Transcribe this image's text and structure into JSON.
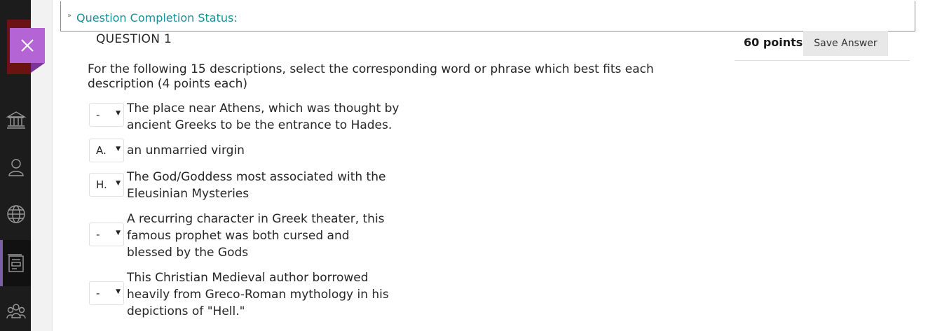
{
  "status": {
    "label": "Question Completion Status:"
  },
  "question": {
    "title": "QUESTION 1",
    "points": "60 points",
    "save_label": "Save Answer",
    "intro_line1": "For the following 15 descriptions, select the corresponding word or phrase which best fits each",
    "intro_line2": "description (4 points each)"
  },
  "items": [
    {
      "selected": "-",
      "lines": [
        "The place near Athens, which was thought by",
        "ancient Greeks to be the entrance to Hades."
      ]
    },
    {
      "selected": "A.",
      "lines": [
        "an unmarried virgin"
      ]
    },
    {
      "selected": "H.",
      "lines": [
        "The God/Goddess most associated with the",
        "Eleusinian Mysteries"
      ]
    },
    {
      "selected": "-",
      "lines": [
        "A recurring character in Greek theater, this",
        "famous prophet was both cursed and",
        "blessed by the Gods"
      ]
    },
    {
      "selected": "-",
      "lines": [
        "This Christian Medieval author borrowed",
        "heavily from Greco-Roman mythology in his",
        "depictions of \"Hell.\""
      ]
    }
  ],
  "nav_icons": [
    "institution-icon",
    "profile-icon",
    "globe-icon",
    "courses-icon",
    "groups-icon"
  ],
  "colors": {
    "accent_teal": "#1b8f99",
    "close_purple": "#b564d6",
    "rail": "#1c1c1c"
  }
}
